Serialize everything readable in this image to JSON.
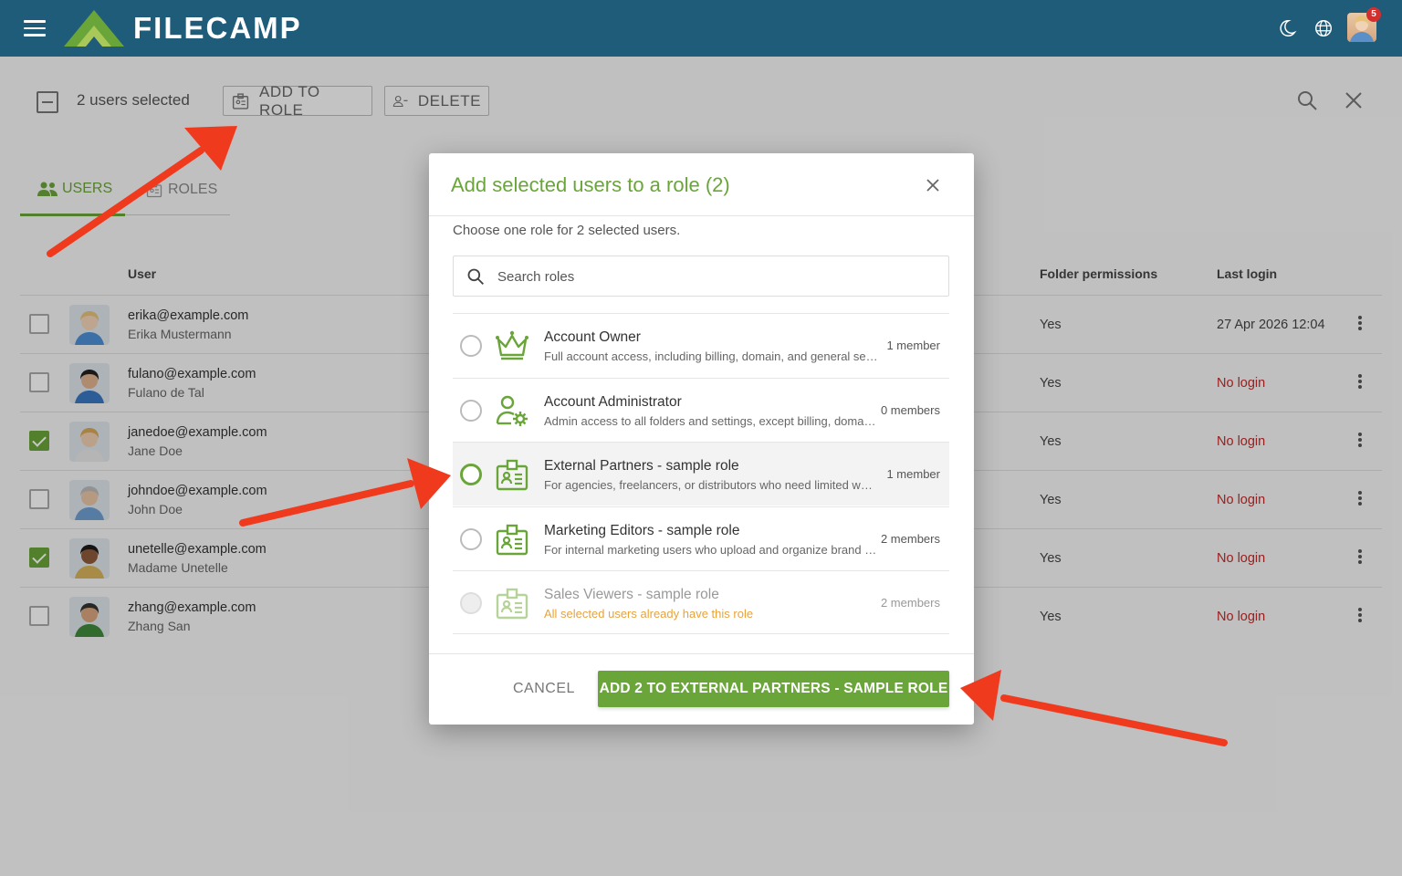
{
  "app": {
    "brand": "FILECAMP",
    "notification_count": "5"
  },
  "toolbar": {
    "selection_text": "2 users selected",
    "add_to_role": "ADD TO ROLE",
    "delete": "DELETE"
  },
  "tabs": {
    "users": "USERS",
    "roles": "ROLES"
  },
  "columns": {
    "user": "User",
    "folder_permissions": "Folder permissions",
    "last_login": "Last login"
  },
  "users": [
    {
      "email": "erika@example.com",
      "name": "Erika Mustermann",
      "checked": false,
      "permissions": "Yes",
      "last_login": "27 Apr 2026 12:04",
      "no_login": false
    },
    {
      "email": "fulano@example.com",
      "name": "Fulano de Tal",
      "checked": false,
      "permissions": "Yes",
      "last_login": "No login",
      "no_login": true
    },
    {
      "email": "janedoe@example.com",
      "name": "Jane Doe",
      "checked": true,
      "permissions": "Yes",
      "last_login": "No login",
      "no_login": true
    },
    {
      "email": "johndoe@example.com",
      "name": "John Doe",
      "checked": false,
      "permissions": "Yes",
      "last_login": "No login",
      "no_login": true
    },
    {
      "email": "unetelle@example.com",
      "name": "Madame Unetelle",
      "checked": true,
      "permissions": "Yes",
      "last_login": "No login",
      "no_login": true
    },
    {
      "email": "zhang@example.com",
      "name": "Zhang San",
      "checked": false,
      "permissions": "Yes",
      "last_login": "No login",
      "no_login": true
    }
  ],
  "dialog": {
    "title": "Add selected users to a role (2)",
    "subtitle": "Choose one role for 2 selected users.",
    "search_placeholder": "Search roles",
    "roles": [
      {
        "name": "Account Owner",
        "description": "Full account access, including billing, domain, and general settings.",
        "members": "1 member",
        "icon": "crown-icon",
        "state": "normal"
      },
      {
        "name": "Account Administrator",
        "description": "Admin access to all folders and settings, except billing, domain and general settings.",
        "members": "0 members",
        "icon": "user-gear-icon",
        "state": "normal"
      },
      {
        "name": "External Partners - sample role",
        "description": "For agencies, freelancers, or distributors who need limited working access.",
        "members": "1 member",
        "icon": "id-badge-icon",
        "state": "selected"
      },
      {
        "name": "Marketing Editors - sample role",
        "description": "For internal marketing users who upload and organize brand assets.",
        "members": "2 members",
        "icon": "id-badge-icon",
        "state": "normal"
      },
      {
        "name": "Sales Viewers - sample role",
        "description": "All selected users already have this role",
        "members": "2 members",
        "icon": "id-badge-icon",
        "state": "disabled"
      }
    ],
    "cancel_label": "CANCEL",
    "confirm_label": "ADD 2 TO EXTERNAL PARTNERS - SAMPLE ROLE"
  },
  "colors": {
    "brand_green": "#6aa539",
    "topbar": "#1f5c7a",
    "annotation_arrow": "#f03a1e",
    "error": "#c62828"
  }
}
